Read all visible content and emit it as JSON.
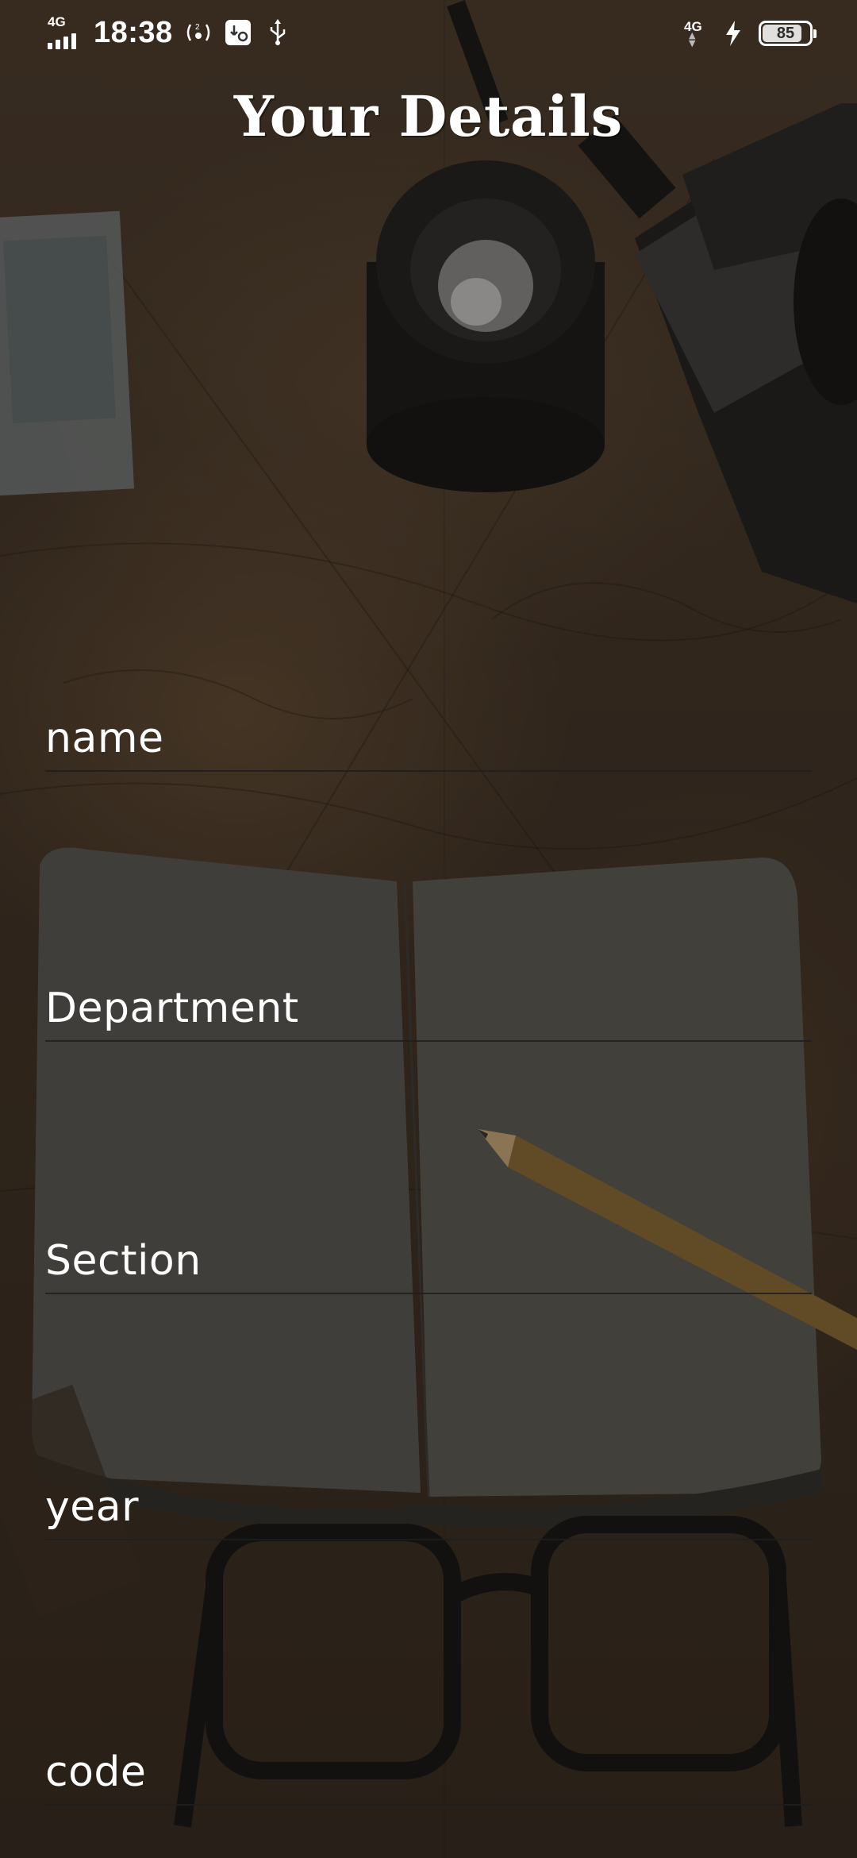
{
  "status_bar": {
    "network_left": "4G",
    "time": "18:38",
    "network_right": "4G",
    "battery_level": 85,
    "battery_label": "85",
    "icons": [
      "signal-bars-icon",
      "wifi-calling-icon",
      "usb-debug-icon",
      "usb-icon",
      "charging-bolt-icon",
      "battery-icon"
    ]
  },
  "header": {
    "title": "Your Details"
  },
  "form": {
    "name": {
      "placeholder": "name"
    },
    "department": {
      "placeholder": "Department"
    },
    "section": {
      "placeholder": "Section"
    },
    "year": {
      "placeholder": "year"
    },
    "code": {
      "placeholder": "code"
    }
  },
  "colors": {
    "text": "#ffffff",
    "underline": "#1e1e1e",
    "background": "#3a2d22"
  }
}
